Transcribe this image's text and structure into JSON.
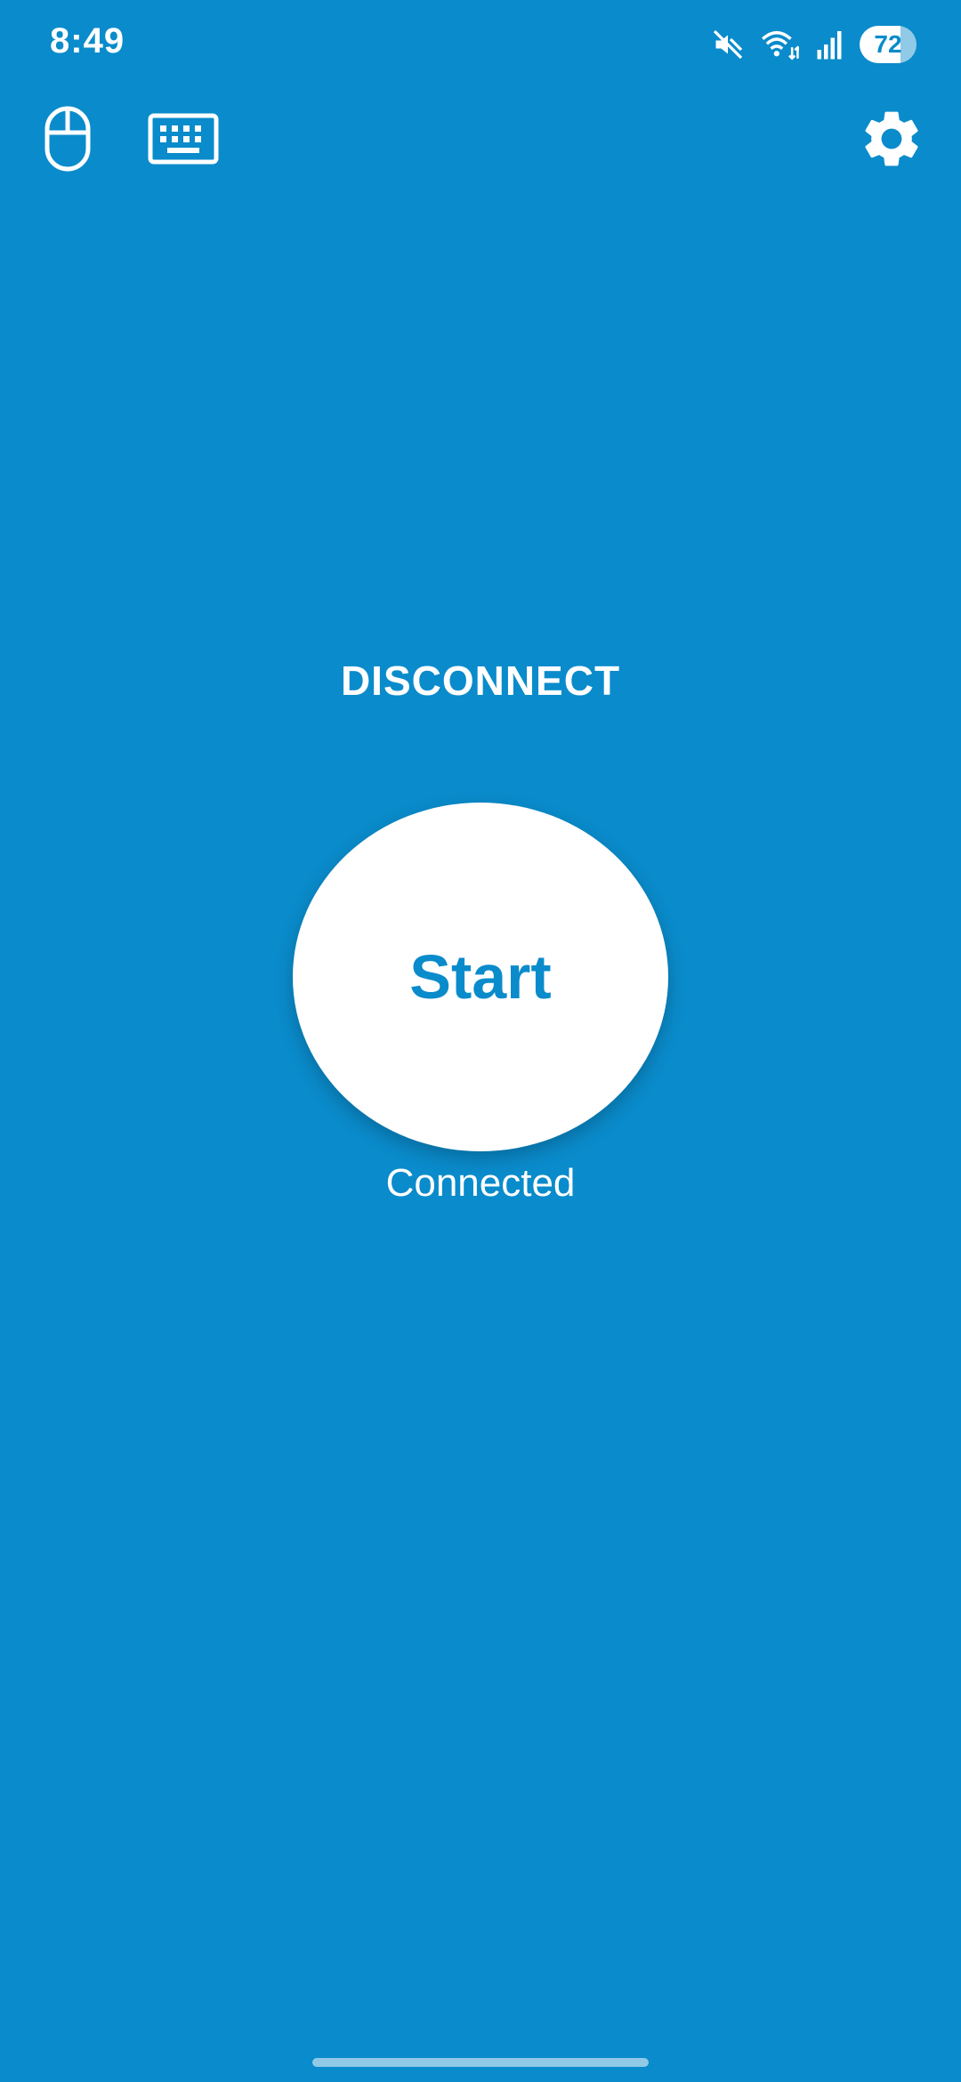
{
  "status_bar": {
    "time": "8:49",
    "battery_level": "72",
    "battery_fraction": 0.72,
    "icons": [
      "mute-icon",
      "wifi-icon",
      "signal-icon",
      "battery-icon"
    ]
  },
  "toolbar": {
    "icons": [
      "mouse-icon",
      "keyboard-icon",
      "gear-icon"
    ]
  },
  "main": {
    "disconnect_label": "DISCONNECT",
    "start_label": "Start",
    "connection_status": "Connected"
  },
  "colors": {
    "background": "#0A8BCB",
    "accent_text": "#0A8BCB",
    "button_bg": "#FFFFFF"
  }
}
